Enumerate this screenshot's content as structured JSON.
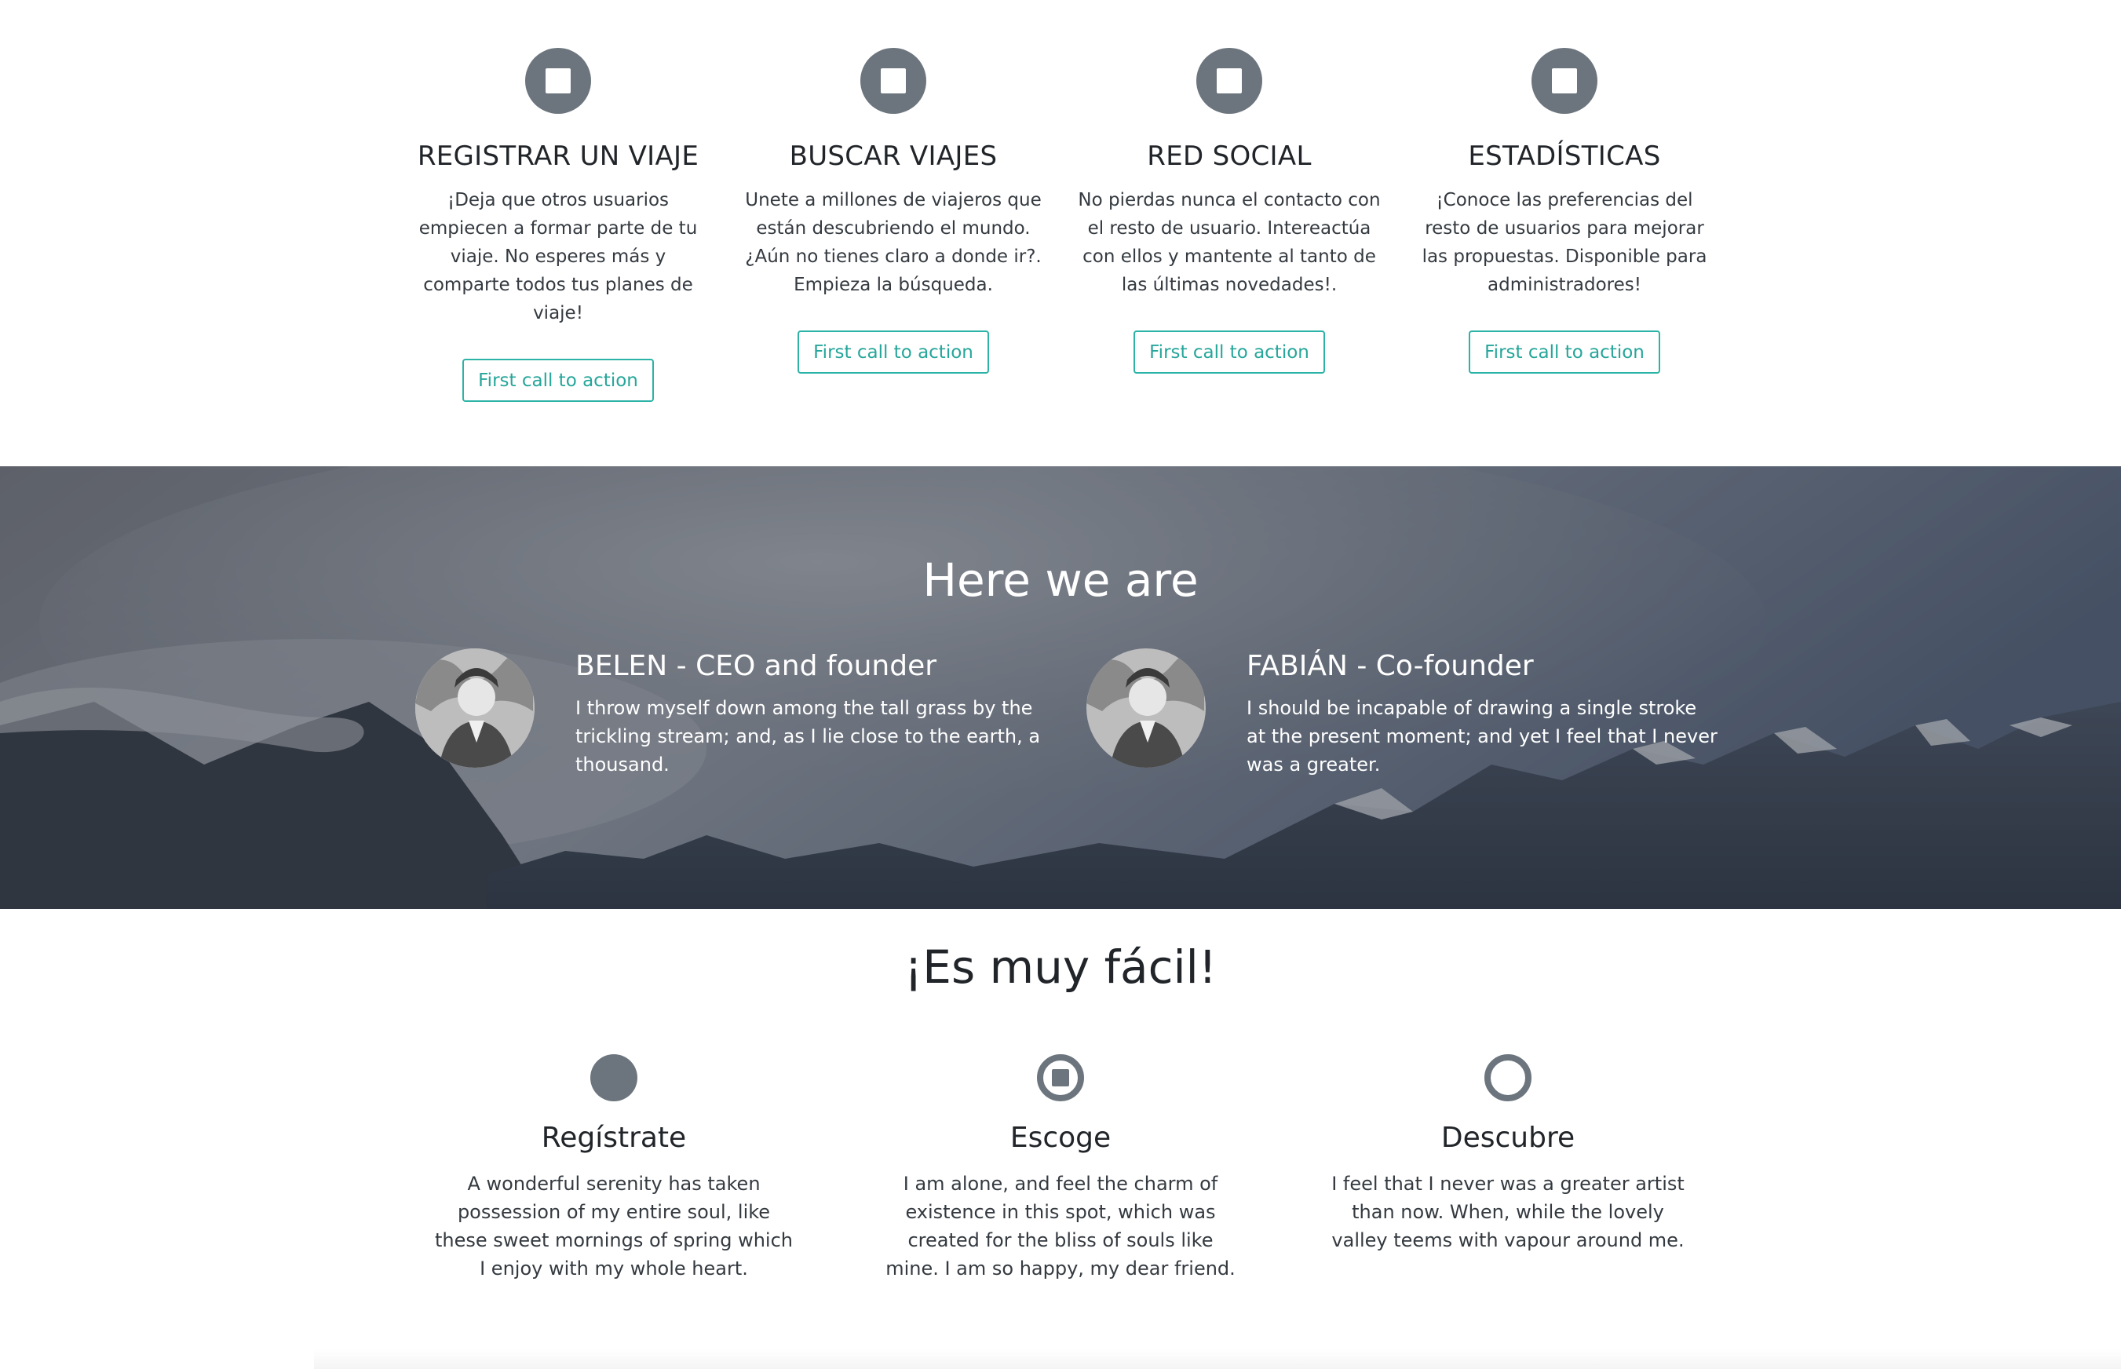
{
  "features": [
    {
      "icon": "stop-circle-icon",
      "title": "REGISTRAR UN VIAJE",
      "text": "¡Deja que otros usuarios empiecen a formar parte de tu viaje. No esperes más y comparte todos tus planes de viaje!",
      "cta": "First call to action"
    },
    {
      "icon": "stop-circle-icon",
      "title": "BUSCAR VIAJES",
      "text": "Unete a millones de viajeros que están descubriendo el mundo. ¿Aún no tienes claro a donde ir?. Empieza la búsqueda.",
      "cta": "First call to action"
    },
    {
      "icon": "stop-circle-icon",
      "title": "RED SOCIAL",
      "text": "No pierdas nunca el contacto con el resto de usuario. Intereactúa con ellos y mantente al tanto de las últimas novedades!.",
      "cta": "First call to action"
    },
    {
      "icon": "stop-circle-icon",
      "title": "ESTADÍSTICAS",
      "text": "¡Conoce las preferencias del resto de usuarios para mejorar las propuestas. Disponible para administradores!",
      "cta": "First call to action"
    }
  ],
  "team": {
    "heading": "Here we are",
    "background": "mountain-landscape-image",
    "members": [
      {
        "name_bold": "BELEN",
        "name_rest": " - CEO and founder",
        "bio": "I throw myself down among the tall grass by the trickling stream; and, as I lie close to the earth, a thousand."
      },
      {
        "name_bold": "FABIÁN",
        "name_rest": " - Co-founder",
        "bio": "I should be incapable of drawing a single stroke at the present moment; and yet I feel that I never was a greater."
      }
    ]
  },
  "steps": {
    "heading": "¡Es muy fácil!",
    "items": [
      {
        "icon": "filled-circle-icon",
        "title": "Regístrate",
        "text": "A wonderful serenity has taken possession of my entire soul, like these sweet mornings of spring which I enjoy with my whole heart."
      },
      {
        "icon": "stop-circle-outline-icon",
        "title": "Escoge",
        "text": "I am alone, and feel the charm of existence in this spot, which was created for the bliss of souls like mine. I am so happy, my dear friend."
      },
      {
        "icon": "circle-outline-icon",
        "title": "Descubre",
        "text": "I feel that I never was a greater artist than now. When, while the lovely valley teems with vapour around me."
      }
    ]
  },
  "colors": {
    "icon_gray": "#6c757d",
    "accent_teal": "#26a69a",
    "text_dark": "#212529"
  }
}
